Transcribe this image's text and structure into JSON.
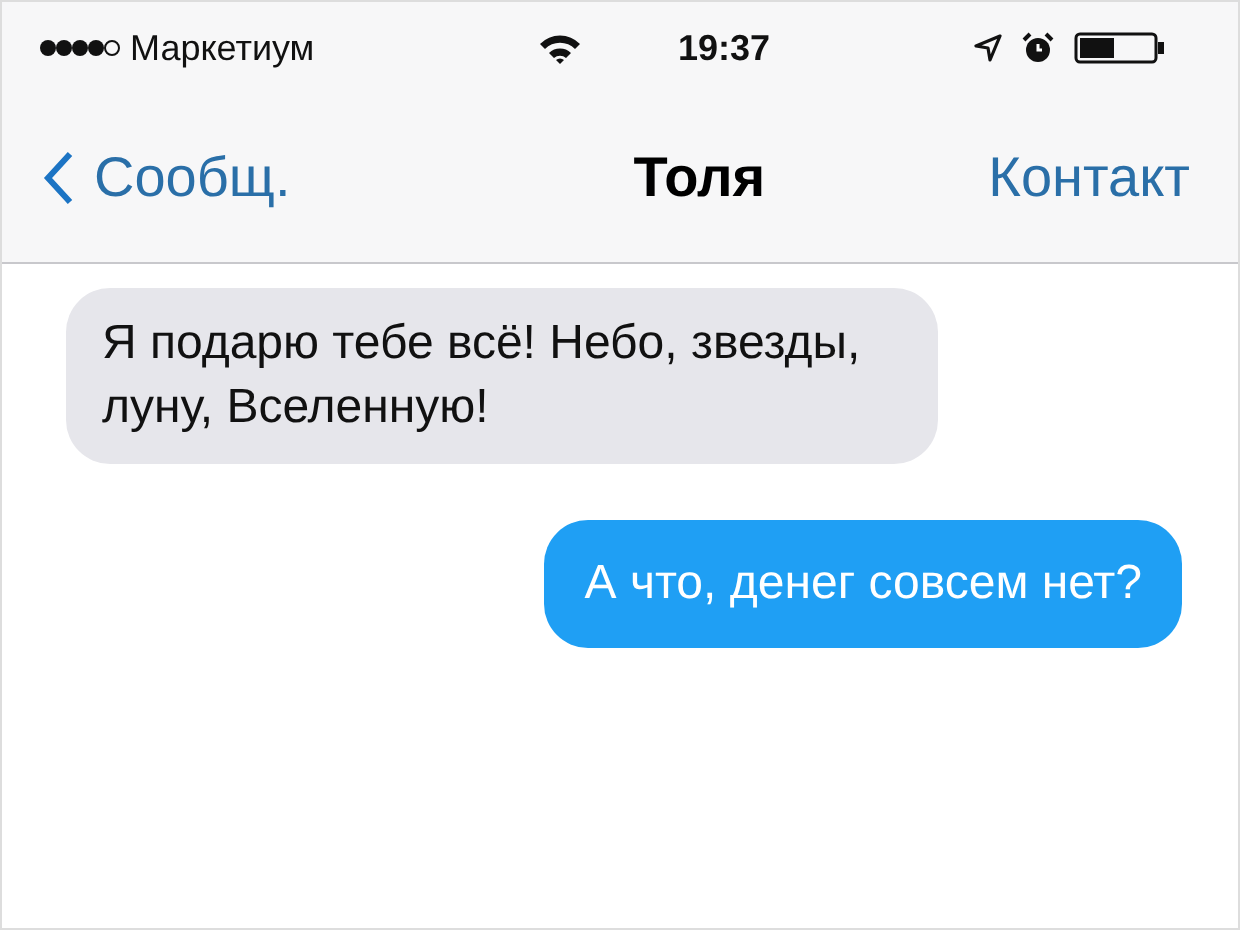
{
  "status_bar": {
    "carrier": "Маркетиум",
    "time": "19:37"
  },
  "nav": {
    "back": "Сообщ.",
    "title": "Толя",
    "action": "Контакт"
  },
  "messages": [
    {
      "kind": "incoming",
      "text": "Я подарю тебе всё! Небо, звезды, луну, Вселенную!"
    },
    {
      "kind": "outgoing",
      "text": "А что, денег совсем нет?"
    }
  ]
}
